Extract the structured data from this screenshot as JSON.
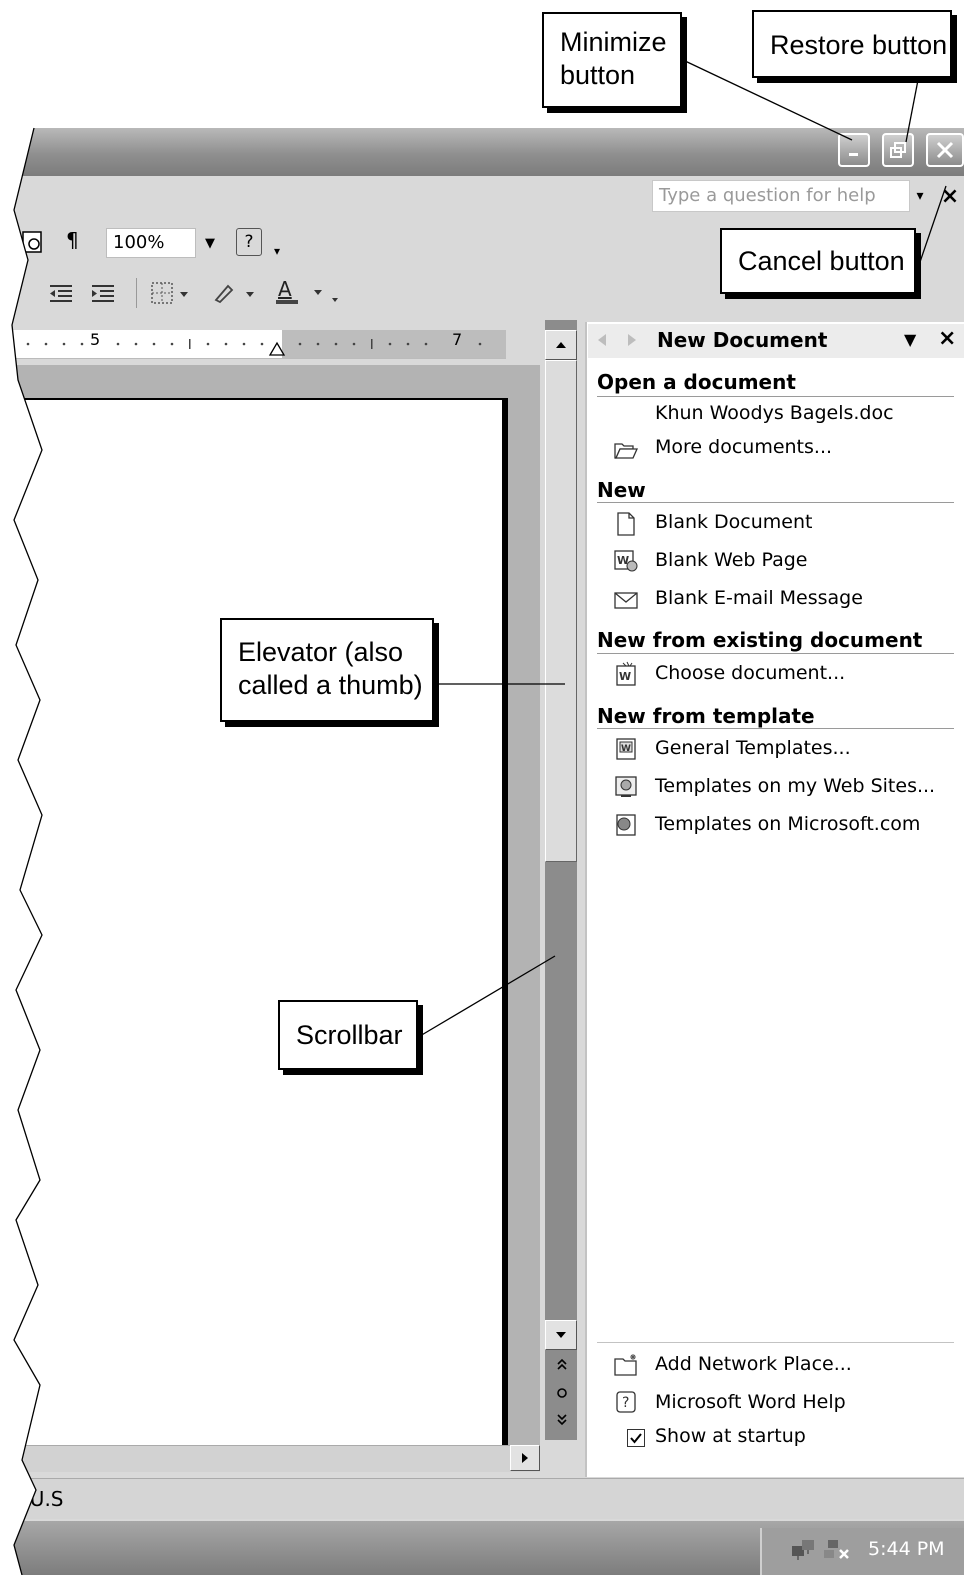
{
  "help": {
    "placeholder": "Type a question for help",
    "dropdown_glyph": "▾",
    "close_glyph": "×"
  },
  "toolbar": {
    "paragraph_glyph": "¶",
    "zoom_value": "100%",
    "help_glyph": "?"
  },
  "ruler": {
    "marks": [
      "5",
      "7"
    ]
  },
  "task_pane": {
    "title": "New Document",
    "sections": {
      "open": {
        "heading": "Open a document",
        "items": [
          "Khun Woodys Bagels.doc",
          "More documents..."
        ]
      },
      "new": {
        "heading": "New",
        "items": [
          "Blank Document",
          "Blank Web Page",
          "Blank E-mail Message"
        ]
      },
      "existing": {
        "heading": "New from existing document",
        "items": [
          "Choose document..."
        ]
      },
      "template": {
        "heading": "New from template",
        "items": [
          "General Templates...",
          "Templates on my Web Sites...",
          "Templates on Microsoft.com"
        ]
      }
    },
    "footer": {
      "items": [
        "Add Network Place...",
        "Microsoft Word Help"
      ],
      "checkbox_label": "Show at startup",
      "checkbox_checked": true
    }
  },
  "status_bar": {
    "text": "(U.S"
  },
  "taskbar": {
    "clock": "5:44 PM"
  },
  "callouts": {
    "minimize": "Minimize button",
    "restore": "Restore button",
    "cancel": "Cancel button",
    "elevator": "Elevator (also called a thumb)",
    "scrollbar": "Scrollbar"
  }
}
